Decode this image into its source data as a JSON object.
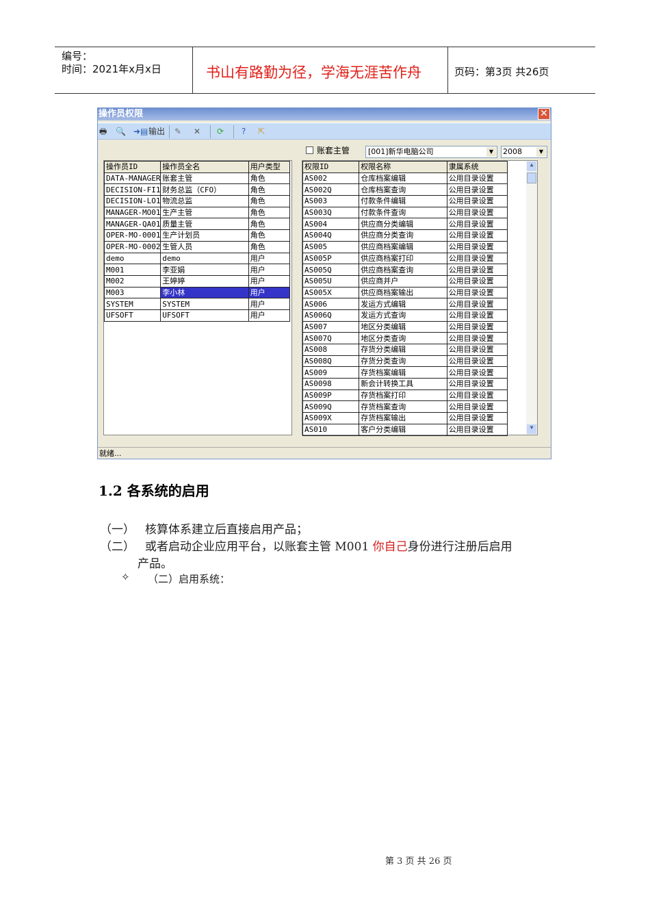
{
  "header": {
    "number_label": "编号：",
    "time_label": "时间：2021年x月x日",
    "motto": "书山有路勤为径，学海无涯苦作舟",
    "page_info": "页码：第3页  共26页"
  },
  "window": {
    "title": "操作员权限",
    "toolbar": {
      "export_label": "输出"
    },
    "checkbox_label": "账套主管",
    "account_select": "[001]新华电脑公司",
    "year_select": "2008",
    "status": "就绪..."
  },
  "operators": {
    "columns": [
      "操作员ID",
      "操作员全名",
      "用户类型"
    ],
    "rows": [
      [
        "DATA-MANAGER",
        "账套主管",
        "角色"
      ],
      [
        "DECISION-FI1",
        "财务总监（CFO）",
        "角色"
      ],
      [
        "DECISION-LO1",
        "物流总监",
        "角色"
      ],
      [
        "MANAGER-MO01",
        "生产主管",
        "角色"
      ],
      [
        "MANAGER-QA01",
        "质量主管",
        "角色"
      ],
      [
        "OPER-MO-0001",
        "生产计划员",
        "角色"
      ],
      [
        "OPER-MO-0002",
        "生管人员",
        "角色"
      ],
      [
        "demo",
        "demo",
        "用户"
      ],
      [
        "M001",
        "李亚娟",
        "用户"
      ],
      [
        "M002",
        "王婷婷",
        "用户"
      ],
      [
        "M003",
        "李小林",
        "用户"
      ],
      [
        "SYSTEM",
        "SYSTEM",
        "用户"
      ],
      [
        "UFSOFT",
        "UFSOFT",
        "用户"
      ]
    ],
    "selected_index": 10
  },
  "permissions": {
    "columns": [
      "权限ID",
      "权限名称",
      "隶属系统"
    ],
    "rows": [
      [
        "AS002",
        "仓库档案编辑",
        "公用目录设置"
      ],
      [
        "AS002Q",
        "仓库档案查询",
        "公用目录设置"
      ],
      [
        "AS003",
        "付款条件编辑",
        "公用目录设置"
      ],
      [
        "AS003Q",
        "付款条件查询",
        "公用目录设置"
      ],
      [
        "AS004",
        "供应商分类编辑",
        "公用目录设置"
      ],
      [
        "AS004Q",
        "供应商分类查询",
        "公用目录设置"
      ],
      [
        "AS005",
        "供应商档案编辑",
        "公用目录设置"
      ],
      [
        "AS005P",
        "供应商档案打印",
        "公用目录设置"
      ],
      [
        "AS005Q",
        "供应商档案查询",
        "公用目录设置"
      ],
      [
        "AS005U",
        "供应商并户",
        "公用目录设置"
      ],
      [
        "AS005X",
        "供应商档案输出",
        "公用目录设置"
      ],
      [
        "AS006",
        "发运方式编辑",
        "公用目录设置"
      ],
      [
        "AS006Q",
        "发运方式查询",
        "公用目录设置"
      ],
      [
        "AS007",
        "地区分类编辑",
        "公用目录设置"
      ],
      [
        "AS007Q",
        "地区分类查询",
        "公用目录设置"
      ],
      [
        "AS008",
        "存货分类编辑",
        "公用目录设置"
      ],
      [
        "AS008Q",
        "存货分类查询",
        "公用目录设置"
      ],
      [
        "AS009",
        "存货档案编辑",
        "公用目录设置"
      ],
      [
        "AS0098",
        "新会计转换工具",
        "公用目录设置"
      ],
      [
        "AS009P",
        "存货档案打印",
        "公用目录设置"
      ],
      [
        "AS009Q",
        "存货档案查询",
        "公用目录设置"
      ],
      [
        "AS009X",
        "存货档案输出",
        "公用目录设置"
      ],
      [
        "AS010",
        "客户分类编辑",
        "公用目录设置"
      ]
    ]
  },
  "body": {
    "heading": "1.2  各系统的启用",
    "item1_label": "（一）",
    "item1_text": "核算体系建立后直接启用产品；",
    "item2_label": "（二）",
    "item2_text_a": "或者启动企业应用平台，以账套主管 M001 ",
    "item2_highlight": "你自己",
    "item2_text_b": "身份进行注册后启用",
    "item2_text_c": "产品。",
    "bullet_symbol": "✧",
    "bullet_text": "（二）启用系统："
  },
  "footer": {
    "page_text": "第 3 页 共 26 页"
  },
  "colors": {
    "motto": "#e0201a",
    "selection": "#3434c8",
    "highlight": "#d02020"
  }
}
